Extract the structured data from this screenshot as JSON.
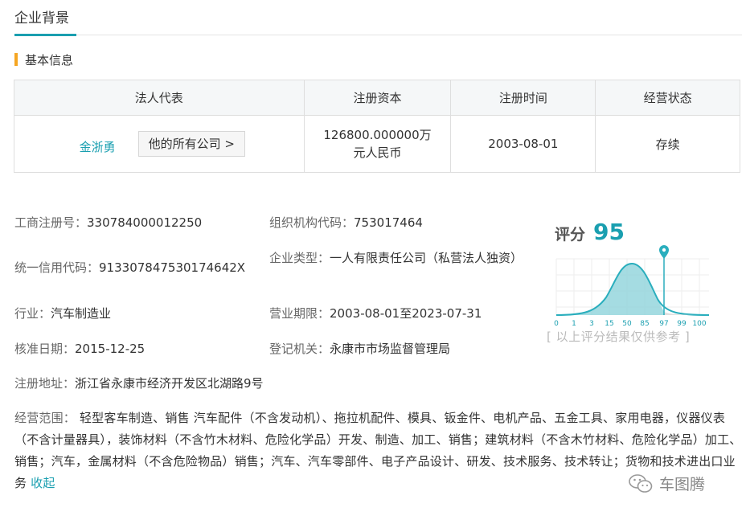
{
  "tabs": {
    "active": "企业背景"
  },
  "section": {
    "title": "基本信息"
  },
  "table": {
    "headers": [
      "法人代表",
      "注册资本",
      "注册时间",
      "经营状态"
    ],
    "legal_rep": "金浙勇",
    "all_companies_btn": "他的所有公司 >",
    "capital_line1": "126800.000000万",
    "capital_line2": "元人民币",
    "reg_date": "2003-08-01",
    "status": "存续"
  },
  "details": {
    "reg_no_label": "工商注册号：",
    "reg_no": "330784000012250",
    "org_code_label": "组织机构代码：",
    "org_code": "753017464",
    "credit_code_label": "统一信用代码：",
    "credit_code": "913307847530174642X",
    "company_type_label": "企业类型：",
    "company_type": "一人有限责任公司（私营法人独资）",
    "industry_label": "行业：",
    "industry": "汽车制造业",
    "term_label": "营业期限：",
    "term": "2003-08-01至2023-07-31",
    "approval_date_label": "核准日期：",
    "approval_date": "2015-12-25",
    "authority_label": "登记机关：",
    "authority": "永康市市场监督管理局",
    "address_label": "注册地址：",
    "address": "浙江省永康市经济开发区北湖路9号"
  },
  "score": {
    "label": "评分",
    "value": "95",
    "ticks": [
      "0",
      "1",
      "3",
      "15",
      "50",
      "85",
      "97",
      "99",
      "100"
    ],
    "note": "[ 以上评分结果仅供参考 ]",
    "accent_color": "#1a9fb0"
  },
  "scope": {
    "label": "经营范围：",
    "text": "轻型客车制造、销售 汽车配件（不含发动机）、拖拉机配件、模具、钣金件、电机产品、五金工具、家用电器，仪器仪表（不含计量器具），装饰材料（不含竹木材料、危险化学品）开发、制造、加工、销售；建筑材料（不含木竹材料、危险化学品）加工、销售；汽车，金属材料（不含危险物品）销售；汽车、汽车零部件、电子产品设计、研发、技术服务、技术转让；货物和技术进出口业务",
    "collapse": "收起"
  },
  "watermark": {
    "text": "车图腾",
    "icon": "wechat-icon"
  }
}
